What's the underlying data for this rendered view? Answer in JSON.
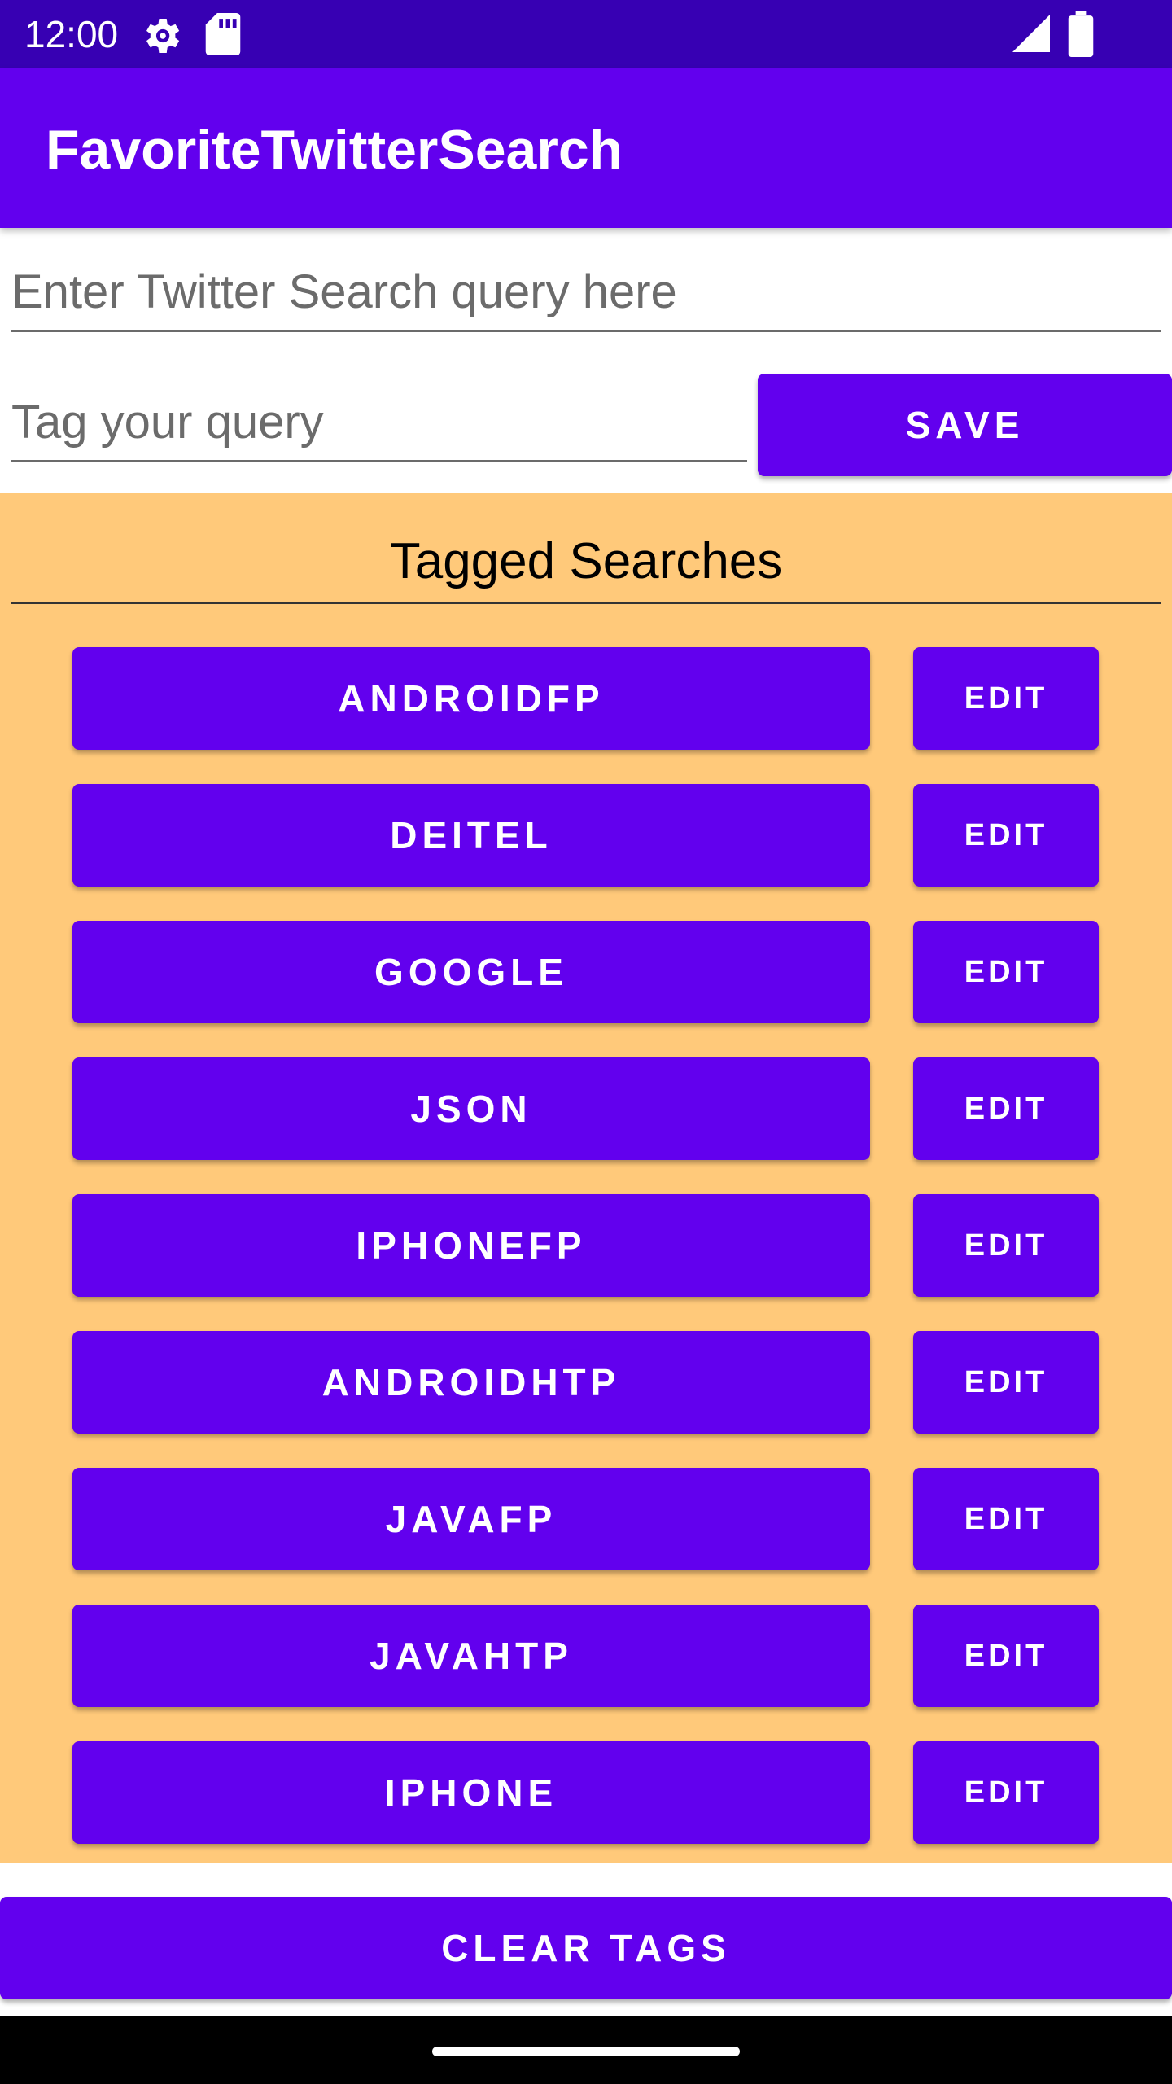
{
  "status_bar": {
    "time": "12:00",
    "icons": [
      "gear-icon",
      "sd-card-icon",
      "signal-icon",
      "battery-icon"
    ]
  },
  "app_bar": {
    "title": "FavoriteTwitterSearch"
  },
  "query_input": {
    "value": "",
    "placeholder": "Enter Twitter Search query here"
  },
  "tag_input": {
    "value": "",
    "placeholder": "Tag your query"
  },
  "save_button": {
    "label": "SAVE"
  },
  "tagged_searches": {
    "heading": "Tagged Searches",
    "edit_label": "EDIT",
    "tags": [
      {
        "label": "ANDROIDFP"
      },
      {
        "label": "DEITEL"
      },
      {
        "label": "GOOGLE"
      },
      {
        "label": "JSON"
      },
      {
        "label": "IPHONEFP"
      },
      {
        "label": "ANDROIDHTP"
      },
      {
        "label": "JAVAFP"
      },
      {
        "label": "JAVAHTP"
      },
      {
        "label": "IPHONE"
      }
    ]
  },
  "clear_button": {
    "label": "CLEAR TAGS"
  },
  "colors": {
    "primary": "#6200ee",
    "primary_dark": "#3700b3",
    "panel_background": "#ffc97a"
  }
}
